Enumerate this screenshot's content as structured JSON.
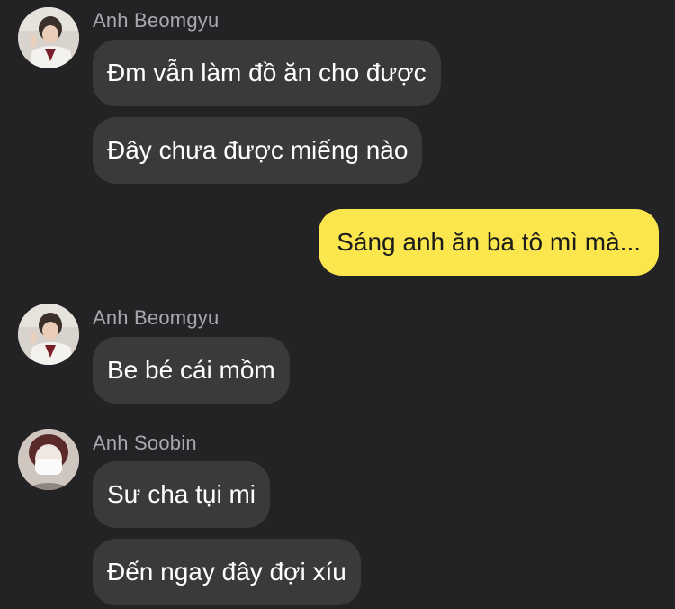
{
  "conversation": {
    "messages": [
      {
        "sender": "Anh Beomgyu",
        "text": "Đm vẫn làm đồ ăn cho được",
        "direction": "incoming"
      },
      {
        "sender": "Anh Beomgyu",
        "text": "Đây chưa được miếng nào",
        "direction": "incoming"
      },
      {
        "sender": "me",
        "text": "Sáng anh ăn ba tô mì mà...",
        "direction": "outgoing"
      },
      {
        "sender": "Anh Beomgyu",
        "text": "Be bé cái mồm",
        "direction": "incoming"
      },
      {
        "sender": "Anh Soobin",
        "text": "Sư cha tụi mi",
        "direction": "incoming"
      },
      {
        "sender": "Anh Soobin",
        "text": "Đến ngay đây đợi xíu",
        "direction": "incoming"
      }
    ],
    "groups": [
      {
        "sender_name": "Anh Beomgyu",
        "avatar_icon": "user-avatar-photo"
      },
      {
        "sender_name": "Anh Beomgyu",
        "avatar_icon": "user-avatar-photo"
      },
      {
        "sender_name": "Anh Soobin",
        "avatar_icon": "user-avatar-masked-photo"
      }
    ]
  },
  "colors": {
    "background": "#232325",
    "incoming_bubble": "#3a3a3c",
    "outgoing_bubble": "#fbe74d",
    "sender_name": "#a9a9ad"
  }
}
